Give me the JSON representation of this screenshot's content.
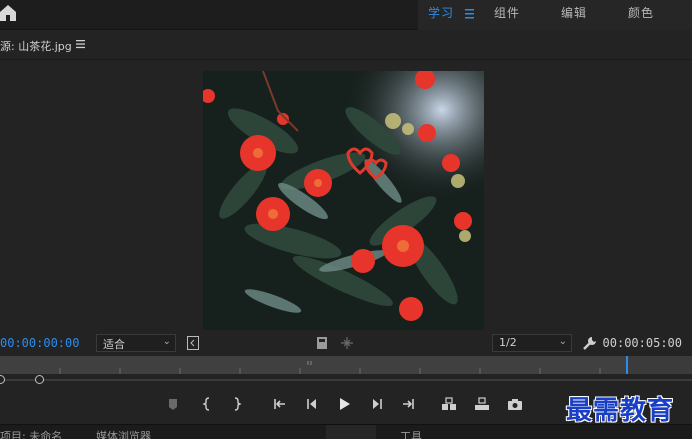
{
  "workspace": {
    "tabs": [
      {
        "label": "学习",
        "active": true
      },
      {
        "label": "组件",
        "active": false
      },
      {
        "label": "编辑",
        "active": false
      },
      {
        "label": "颜色",
        "active": false
      }
    ]
  },
  "source_panel": {
    "title": "源: 山茶花.jpg"
  },
  "controls": {
    "current_timecode": "00:00:00:00",
    "fit_select": "适合",
    "resolution_select": "1/2",
    "duration_timecode": "00:00:05:00"
  },
  "bottom_tabs": {
    "project": "项目: 未命名",
    "media_browser": "媒体浏览器",
    "tab3": "",
    "tab4": "工具"
  },
  "watermark": "最需教育",
  "colors": {
    "accent": "#2d8ceb",
    "panel_bg": "#232323",
    "watermark": "#1a3fc7"
  },
  "icons": [
    "home-icon",
    "hamburger-menu-icon",
    "panel-menu-icon",
    "safe-margin-icon",
    "export-frame-icon",
    "drag-video-icon",
    "wrench-icon",
    "add-marker-icon",
    "mark-in-icon",
    "mark-out-icon",
    "go-to-in-icon",
    "step-back-icon",
    "play-icon",
    "step-forward-icon",
    "go-to-out-icon",
    "insert-icon",
    "overwrite-icon",
    "camera-icon"
  ]
}
